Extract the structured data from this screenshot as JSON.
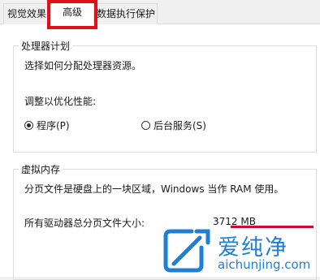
{
  "tabs": [
    {
      "label": "视觉效果"
    },
    {
      "label": "高级"
    },
    {
      "label": "数据执行保护"
    }
  ],
  "processor": {
    "legend": "处理器计划",
    "description": "选择如何分配处理器资源。",
    "adjust_label": "调整以优化性能:",
    "options": [
      {
        "label": "程序(P)",
        "checked": true
      },
      {
        "label": "后台服务(S)",
        "checked": false
      }
    ]
  },
  "virtual_memory": {
    "legend": "虚拟内存",
    "description": "分页文件是硬盘上的一块区域，Windows 当作 RAM 使用。",
    "total_label": "所有驱动器总分页文件大小:",
    "total_value": "3712 MB"
  },
  "watermark": {
    "name": "爱纯净",
    "url": "aichunjing.com"
  },
  "colors": {
    "highlight": "#e0101a",
    "watermark": "#1e7fd6"
  }
}
